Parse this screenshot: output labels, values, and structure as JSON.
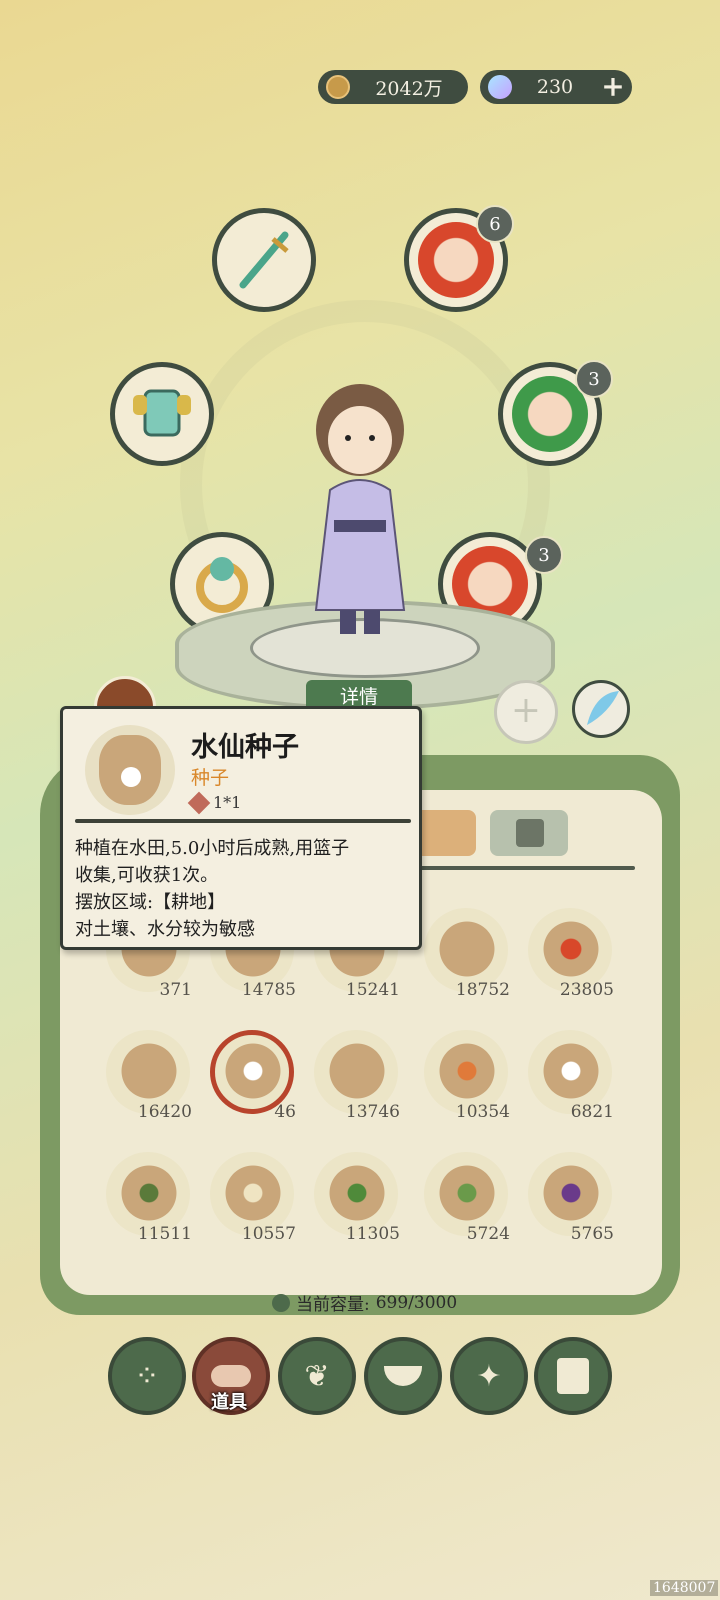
{
  "currency": {
    "coins": "2042万",
    "gems": "230"
  },
  "slots": {
    "companion_1_count": "6",
    "companion_2_count": "3",
    "companion_3_count": "3"
  },
  "detail_button": "详情",
  "tooltip": {
    "name": "水仙种子",
    "type": "种子",
    "size": "1*1",
    "desc_line1": "种植在水田,5.0小时后成熟,用篮子",
    "desc_line2": "收集,可收获1次。",
    "desc_line3": "摆放区域:【耕地】",
    "desc_line4": "对土壤、水分较为敏感"
  },
  "grid": [
    {
      "count": "371"
    },
    {
      "count": "14785"
    },
    {
      "count": "15241"
    },
    {
      "count": "18752"
    },
    {
      "count": "23805"
    },
    {
      "count": "16420"
    },
    {
      "count": "46"
    },
    {
      "count": "13746"
    },
    {
      "count": "10354"
    },
    {
      "count": "6821"
    },
    {
      "count": "11511"
    },
    {
      "count": "10557"
    },
    {
      "count": "11305"
    },
    {
      "count": "5724"
    },
    {
      "count": "5765"
    }
  ],
  "capacity": {
    "label": "当前容量:",
    "value": "699/3000"
  },
  "nav": {
    "active_label": "道具"
  },
  "watermark": "1648007",
  "colors": {
    "panel": "#7d9a63",
    "dark": "#3f4c40",
    "accent": "#d9872a"
  }
}
